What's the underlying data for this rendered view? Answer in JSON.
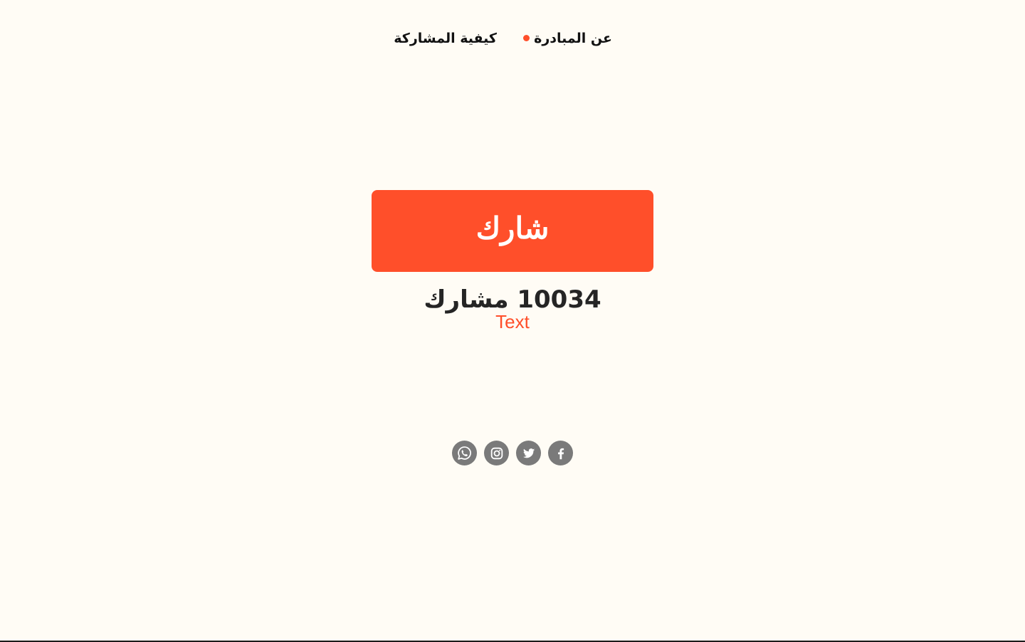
{
  "nav": {
    "about_label": "عن المبادرة",
    "how_label": "كيفية المشاركة",
    "dot_color": "#ff4f2a"
  },
  "share_button": {
    "label": "شارك",
    "color": "#ff4f2a"
  },
  "participants": {
    "text": "10034 مشارك",
    "count": 10034
  },
  "subtext": "Text",
  "socials": [
    {
      "icon": "whatsapp-icon"
    },
    {
      "icon": "instagram-icon"
    },
    {
      "icon": "twitter-icon"
    },
    {
      "icon": "facebook-icon"
    }
  ],
  "colors": {
    "background": "#fffcf5",
    "accent": "#ff4f2a",
    "icon_gray": "#7a7a7a",
    "text_dark": "#252525"
  }
}
